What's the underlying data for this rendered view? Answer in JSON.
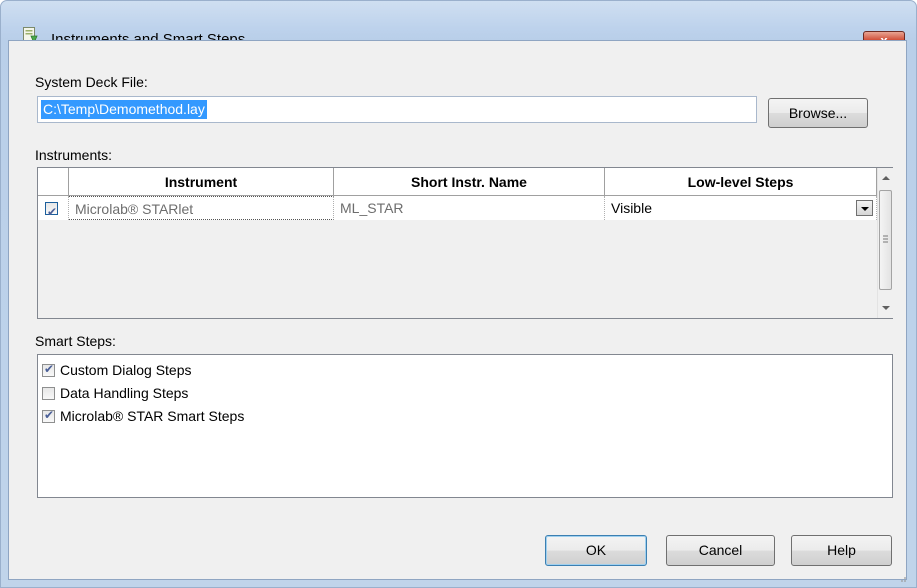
{
  "window": {
    "title": "Instruments and Smart Steps",
    "close_label": "x"
  },
  "deck": {
    "label": "System Deck File:",
    "path": "C:\\Temp\\Demomethod.lay",
    "browse_label": "Browse..."
  },
  "instruments": {
    "label": "Instruments:",
    "columns": [
      "Instrument",
      "Short Instr. Name",
      "Low-level Steps"
    ],
    "rows": [
      {
        "checked": true,
        "instrument": "Microlab® STARlet",
        "short_name": "ML_STAR",
        "low_level_steps": "Visible"
      }
    ]
  },
  "smart_steps": {
    "label": "Smart Steps:",
    "items": [
      {
        "label": "Custom Dialog Steps",
        "checked": true
      },
      {
        "label": "Data Handling Steps",
        "checked": false
      },
      {
        "label": "Microlab® STAR Smart Steps",
        "checked": true
      }
    ]
  },
  "buttons": {
    "ok": "OK",
    "cancel": "Cancel",
    "help": "Help"
  }
}
